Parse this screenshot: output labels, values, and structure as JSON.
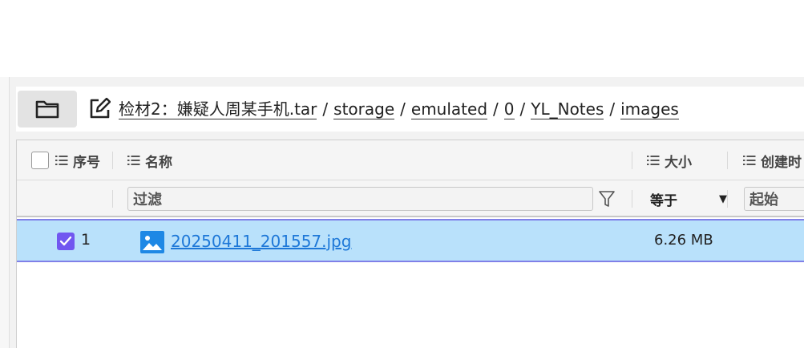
{
  "breadcrumb": {
    "items": [
      "检材2：嫌疑人周某手机.tar",
      "storage",
      "emulated",
      "0",
      "YL_Notes",
      "images"
    ],
    "separator": "/"
  },
  "table": {
    "columns": {
      "index": "序号",
      "name": "名称",
      "size": "大小",
      "created": "创建时"
    },
    "filters": {
      "name_placeholder": "过滤",
      "size_operator": "等于",
      "created_from": "起始"
    },
    "rows": [
      {
        "index": "1",
        "name": "20250411_201557.jpg",
        "size": "6.26 MB",
        "selected": true
      }
    ]
  },
  "icons": {
    "folder": "folder-icon",
    "edit": "edit-icon",
    "filter": "filter-funnel-icon",
    "column_menu": "list-icon",
    "file": "image-file-icon"
  },
  "colors": {
    "selection_bg": "#b9e1fb",
    "selection_border": "#8080e8",
    "checkbox_checked": "#7157f0",
    "link": "#1e78d8",
    "file_icon": "#1e88e5"
  }
}
